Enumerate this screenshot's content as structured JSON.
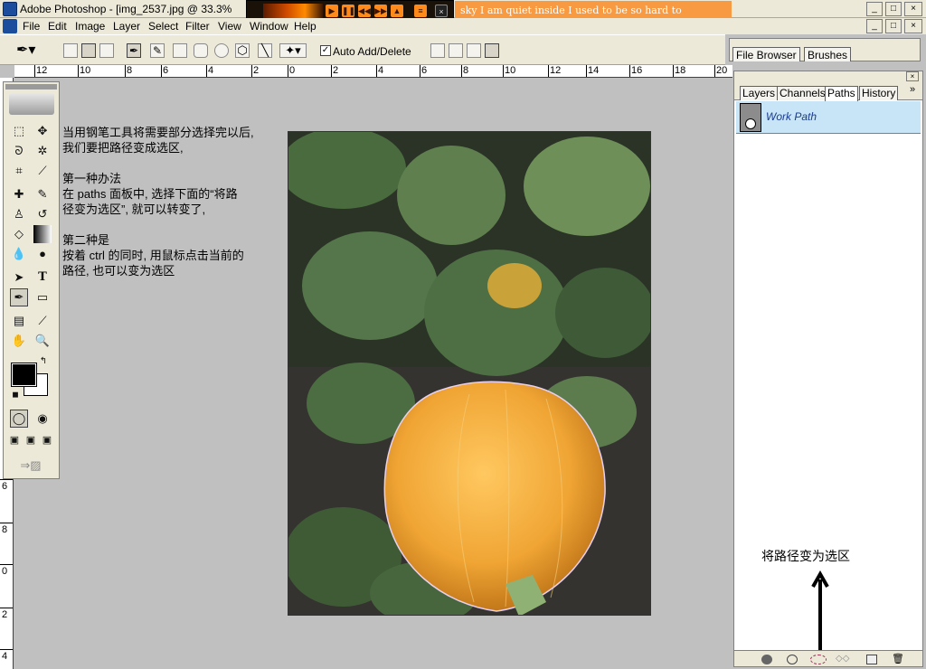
{
  "window": {
    "title": "Adobe Photoshop - [img_2537.jpg @ 33.3%",
    "controls": {
      "minimize": "_",
      "restore": "□",
      "close": "×"
    }
  },
  "player": {
    "lyrics": "sky  I am quiet inside   I used to be so hard to"
  },
  "menu": {
    "items": [
      "File",
      "Edit",
      "Image",
      "Layer",
      "Select",
      "Filter",
      "View",
      "Window",
      "Help"
    ]
  },
  "options_bar": {
    "auto_add_delete_label": "Auto Add/Delete",
    "auto_add_delete_checked": true
  },
  "well": {
    "tabs": [
      "File Browser",
      "Brushes"
    ]
  },
  "rulers": {
    "horizontal": [
      "12",
      "10",
      "8",
      "6",
      "4",
      "2",
      "0",
      "2",
      "4",
      "6",
      "8",
      "10",
      "12",
      "14",
      "16",
      "18",
      "20"
    ],
    "vertical": [
      "6",
      "8",
      "0",
      "2",
      "4"
    ]
  },
  "instructions": {
    "lines": [
      "当用钢笔工具将需要部分选择完以后,",
      "我们要把路径变成选区,",
      "",
      "第一种办法",
      "在 paths 面板中, 选择下面的“将路",
      "径变为选区”, 就可以转变了,",
      "",
      "第二种是",
      "按着 ctrl 的同时, 用鼠标点击当前的",
      "路径, 也可以变为选区"
    ]
  },
  "panel": {
    "tabs": [
      "Layers",
      "Channels",
      "Paths",
      "History"
    ],
    "active_tab": "Paths",
    "paths": [
      {
        "name": "Work Path"
      }
    ],
    "annotation": "将路径变为选区",
    "bottom_buttons": [
      "fill-path",
      "stroke-path",
      "load-path-as-selection",
      "make-work-path",
      "new-path",
      "delete-path"
    ]
  },
  "colors": {
    "foreground": "#000000",
    "background": "#ffffff",
    "selected_path_row": "#c7e5f6",
    "workspace": "#c0c0c0"
  }
}
